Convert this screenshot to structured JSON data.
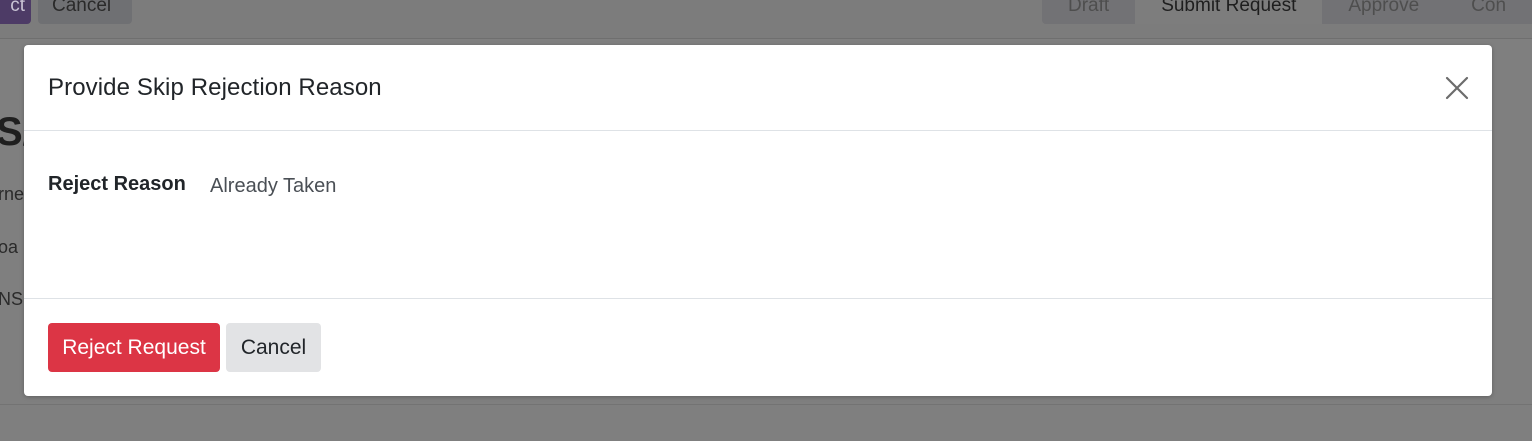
{
  "background": {
    "toolbar": {
      "primary_button_label": "ct",
      "cancel_label": "Cancel"
    },
    "statusbar": {
      "stages": [
        "Draft",
        "Submit Request",
        "Approve",
        "Con"
      ],
      "active_stage": "Submit Request"
    },
    "page_fragments": [
      "S/",
      "rne",
      "oa",
      "NS"
    ]
  },
  "modal": {
    "title": "Provide Skip Rejection Reason",
    "close_icon": "close-icon",
    "field": {
      "label": "Reject Reason",
      "value": "Already Taken"
    },
    "footer": {
      "reject_label": "Reject Request",
      "cancel_label": "Cancel"
    }
  },
  "colors": {
    "danger": "#dc3545",
    "secondary": "#e2e3e5",
    "overlay": "#7f7f7f"
  }
}
